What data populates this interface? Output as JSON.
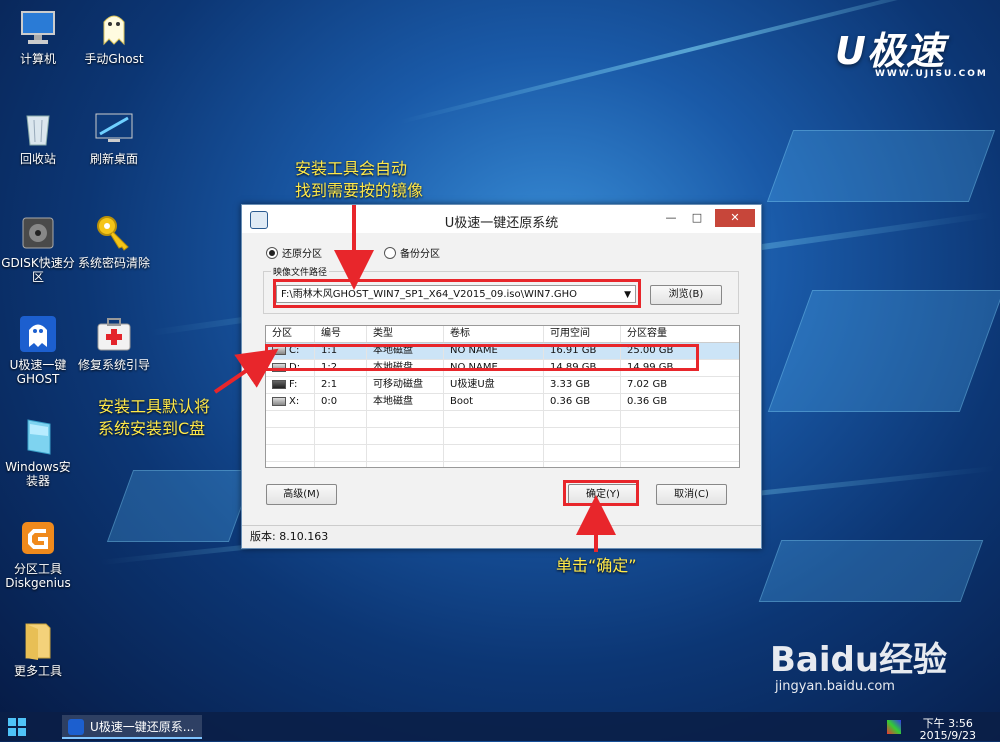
{
  "desktop_icons": [
    {
      "label": "计算机",
      "icon": "computer-icon"
    },
    {
      "label": "手动Ghost",
      "icon": "ghost-icon"
    },
    {
      "label": "回收站",
      "icon": "recycle-bin-icon"
    },
    {
      "label": "刷新桌面",
      "icon": "refresh-desktop-icon"
    },
    {
      "label": "GDISK快速分区",
      "icon": "gdisk-icon"
    },
    {
      "label": "系统密码清除",
      "icon": "key-icon"
    },
    {
      "label": "U极速一键GHOST",
      "icon": "ghost-app-icon"
    },
    {
      "label": "修复系统引导",
      "icon": "repair-kit-icon"
    },
    {
      "label": "Windows安装器",
      "icon": "windows-installer-icon"
    },
    {
      "label": "分区工具Diskgenius",
      "icon": "diskgenius-icon"
    },
    {
      "label": "更多工具",
      "icon": "folder-icon"
    }
  ],
  "logo": {
    "text": "U极速",
    "url": "WWW.UJISU.COM"
  },
  "annotations": {
    "top_line1": "安装工具会自动",
    "top_line2": "找到需要按的镜像",
    "left_line1": "安装工具默认将",
    "left_line2": "系统安装到C盘",
    "bottom": "单击“确定”"
  },
  "window": {
    "title": "U极速一键还原系统",
    "controls": {
      "minimize": "—",
      "maximize": "□",
      "close": "✕"
    },
    "radio_restore": "还原分区",
    "radio_backup": "备份分区",
    "image_path_label": "映像文件路径",
    "image_path_value": "F:\\雨林木风GHOST_WIN7_SP1_X64_V2015_09.iso\\WIN7.GHO",
    "browse_button": "浏览(B)",
    "table": {
      "headers": [
        "分区",
        "编号",
        "类型",
        "卷标",
        "可用空间",
        "分区容量"
      ],
      "rows": [
        [
          "C:",
          "1:1",
          "本地磁盘",
          "NO NAME",
          "16.91 GB",
          "25.00 GB"
        ],
        [
          "D:",
          "1:2",
          "本地磁盘",
          "NO NAME",
          "14.89 GB",
          "14.99 GB"
        ],
        [
          "F:",
          "2:1",
          "可移动磁盘",
          "U极速U盘",
          "3.33 GB",
          "7.02 GB"
        ],
        [
          "X:",
          "0:0",
          "本地磁盘",
          "Boot",
          "0.36 GB",
          "0.36 GB"
        ]
      ]
    },
    "advanced_button": "高级(M)",
    "ok_button": "确定(Y)",
    "cancel_button": "取消(C)",
    "version": "版本: 8.10.163"
  },
  "taskbar": {
    "task_label": "U极速一键还原系...",
    "clock_line1": "下午 3:56",
    "clock_line2": "2015/9/23"
  },
  "watermark": {
    "brand": "Baidu经验",
    "url": "jingyan.baidu.com"
  },
  "colors": {
    "annotation": "#ffe94a",
    "highlight": "#e8262b",
    "selection": "#cce4f7"
  }
}
